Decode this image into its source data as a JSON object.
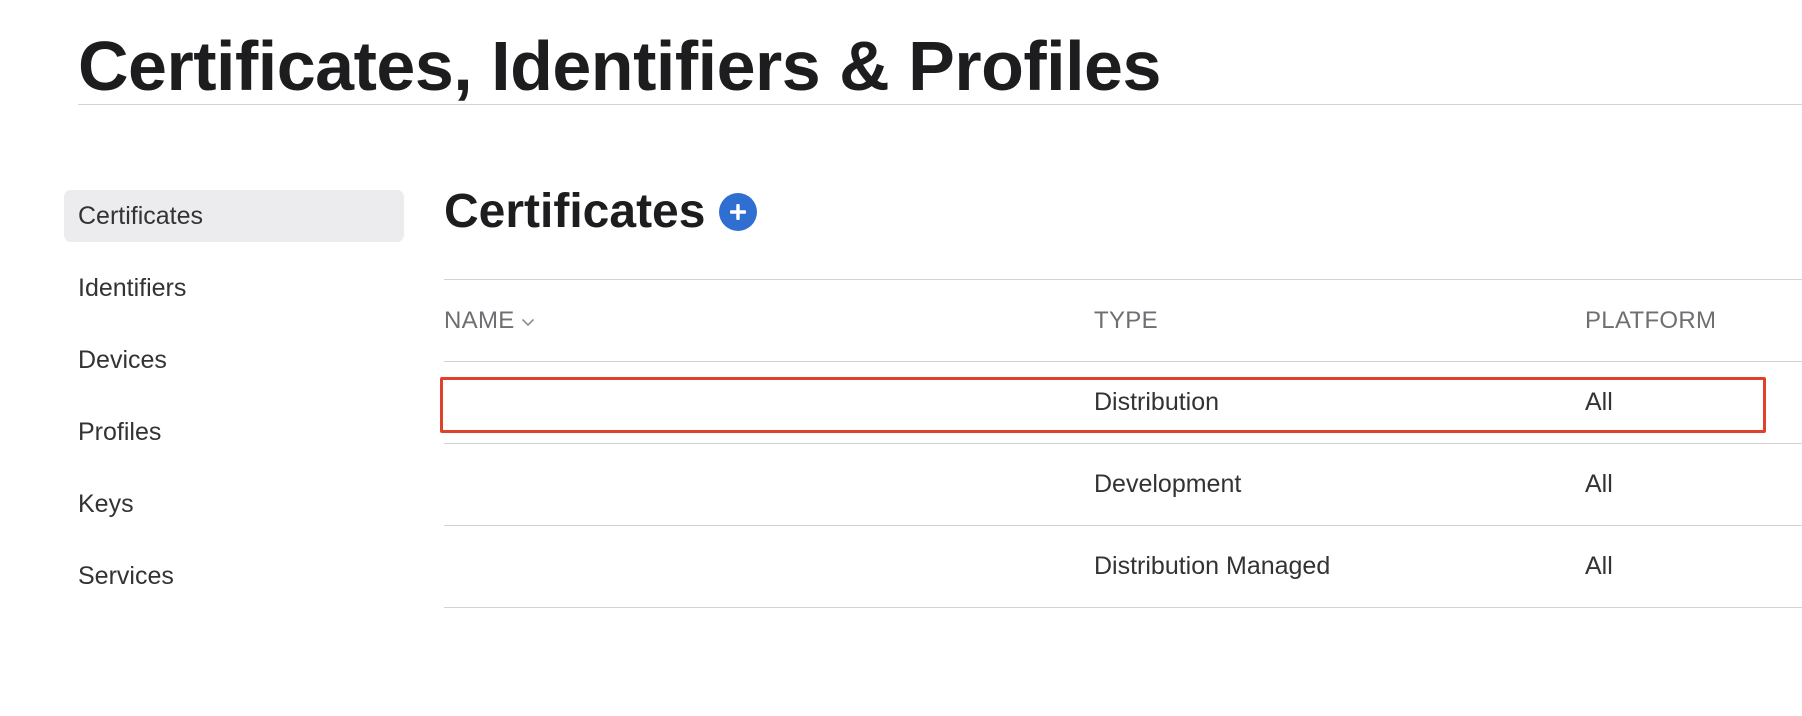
{
  "page": {
    "title": "Certificates, Identifiers & Profiles"
  },
  "sidebar": {
    "items": [
      {
        "label": "Certificates",
        "active": true
      },
      {
        "label": "Identifiers",
        "active": false
      },
      {
        "label": "Devices",
        "active": false
      },
      {
        "label": "Profiles",
        "active": false
      },
      {
        "label": "Keys",
        "active": false
      },
      {
        "label": "Services",
        "active": false
      }
    ]
  },
  "main": {
    "section_title": "Certificates",
    "add_icon": "plus-circle-icon",
    "columns": {
      "name": "NAME",
      "type": "TYPE",
      "platform": "PLATFORM"
    },
    "sort_icon": "chevron-down-icon",
    "rows": [
      {
        "name": "",
        "type": "Distribution",
        "platform": "All",
        "highlighted": true
      },
      {
        "name": "",
        "type": "Development",
        "platform": "All",
        "highlighted": false
      },
      {
        "name": "",
        "type": "Distribution Managed",
        "platform": "All",
        "highlighted": false
      }
    ]
  },
  "colors": {
    "accent": "#2f6fd1",
    "highlight": "#e0412b",
    "sidebar_active_bg": "#ececee",
    "divider": "#d2d2d7"
  }
}
